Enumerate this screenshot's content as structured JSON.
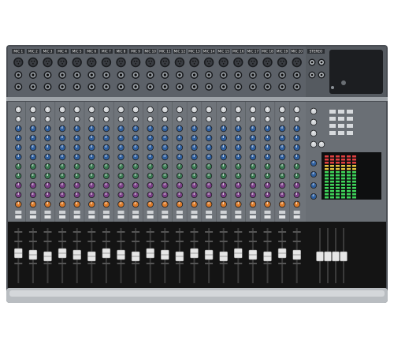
{
  "device": {
    "stereo_label": "STEREO",
    "mic_labels": [
      "MIC 1",
      "MIC 2",
      "MIC 3",
      "MIC 4",
      "MIC 5",
      "MIC 6",
      "MIC 7",
      "MIC 8",
      "MIC 9",
      "MIC 10",
      "MIC 11",
      "MIC 12",
      "MIC 13",
      "MIC 14",
      "MIC 15",
      "MIC 16",
      "MIC 17",
      "MIC 18",
      "MIC 19",
      "MIC 20"
    ]
  },
  "colors": {
    "panel_top": "#5c6168",
    "panel_strip": "#8a9096",
    "panel_mid": "#6f747a",
    "knob_blue": "#2f5f9e",
    "knob_green": "#3a7a52",
    "knob_purple": "#7a3f86",
    "knob_orange": "#d97a2a",
    "fader_bay": "#141414",
    "meter_green": "#3fd45a"
  },
  "icons": {
    "xlr": "xlr-input-jack-icon",
    "trs": "trs-input-jack-icon",
    "knob": "rotary-knob-icon",
    "fader": "fader-cap-icon"
  }
}
